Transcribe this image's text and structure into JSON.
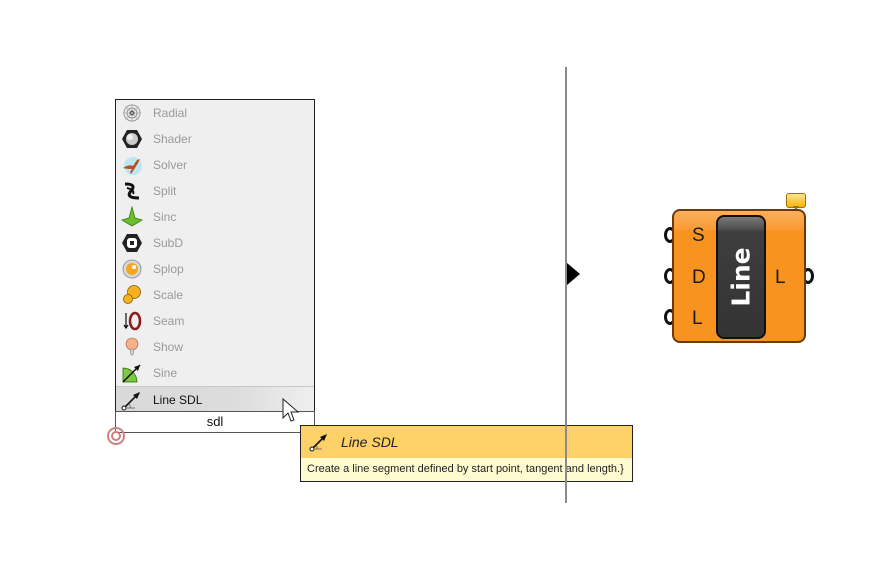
{
  "search_popup": {
    "items": [
      {
        "label": "Radial",
        "icon": "radial-icon"
      },
      {
        "label": "Shader",
        "icon": "shader-icon"
      },
      {
        "label": "Solver",
        "icon": "solver-icon"
      },
      {
        "label": "Split",
        "icon": "split-icon"
      },
      {
        "label": "Sinc",
        "icon": "sinc-icon"
      },
      {
        "label": "SubD",
        "icon": "subd-icon"
      },
      {
        "label": "Splop",
        "icon": "splop-icon"
      },
      {
        "label": "Scale",
        "icon": "scale-icon"
      },
      {
        "label": "Seam",
        "icon": "seam-icon"
      },
      {
        "label": "Show",
        "icon": "show-icon"
      },
      {
        "label": "Sine",
        "icon": "sine-icon"
      },
      {
        "label": "Line SDL",
        "icon": "line-sdl-icon",
        "selected": true
      }
    ],
    "query": "sdl"
  },
  "tooltip": {
    "title": "Line SDL",
    "description": "Create a line segment defined by start point, tangent and length.}",
    "header_color": "#fdd068",
    "body_color": "#fffbd0"
  },
  "component": {
    "name": "Line",
    "inputs": [
      "S",
      "D",
      "L"
    ],
    "outputs": [
      "L"
    ],
    "body_color": "#f7931e"
  }
}
